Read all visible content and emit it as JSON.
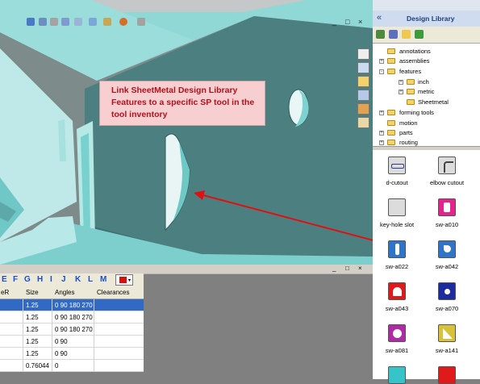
{
  "viewport": {
    "window_controls": [
      "_",
      "□",
      "×"
    ],
    "callout_text": "Link SheetMetal Design Library Features to a specific SP tool in the tool inventory"
  },
  "table": {
    "window_controls": [
      "_",
      "□",
      "×"
    ],
    "column_buttons": [
      "E",
      "F",
      "G",
      "H",
      "I",
      "J",
      "K",
      "L",
      "M"
    ],
    "headers": [
      "eR",
      "Size",
      "Angles",
      "Clearances"
    ],
    "rows": [
      {
        "size": "1.25",
        "angles": "0 90 180 270",
        "selected": true
      },
      {
        "size": "1.25",
        "angles": "0 90 180 270",
        "selected": false
      },
      {
        "size": "1.25",
        "angles": "0 90 180 270",
        "selected": false
      },
      {
        "size": "1.25",
        "angles": "0 90",
        "selected": false
      },
      {
        "size": "1.25",
        "angles": "0 90",
        "selected": false
      },
      {
        "size": "0.76044",
        "angles": "0",
        "selected": false
      }
    ]
  },
  "design_library": {
    "title": "Design Library",
    "collapse_glyph": "«",
    "tree": [
      "annotations",
      "assemblies",
      "features",
      "inch",
      "metric",
      "Sheetmetal",
      "forming tools",
      "motion",
      "parts",
      "routing"
    ],
    "items": [
      "d-cutout",
      "elbow cutout",
      "key-hole slot",
      "sw-a010",
      "sw-a022",
      "sw-a042",
      "sw-a043",
      "sw-a070",
      "sw-a081",
      "sw-a141"
    ]
  },
  "colors": {
    "accent_red": "#e01010",
    "selection_blue": "#316ac5",
    "callout_bg": "#f7cfd0",
    "callout_text": "#b3121c"
  }
}
